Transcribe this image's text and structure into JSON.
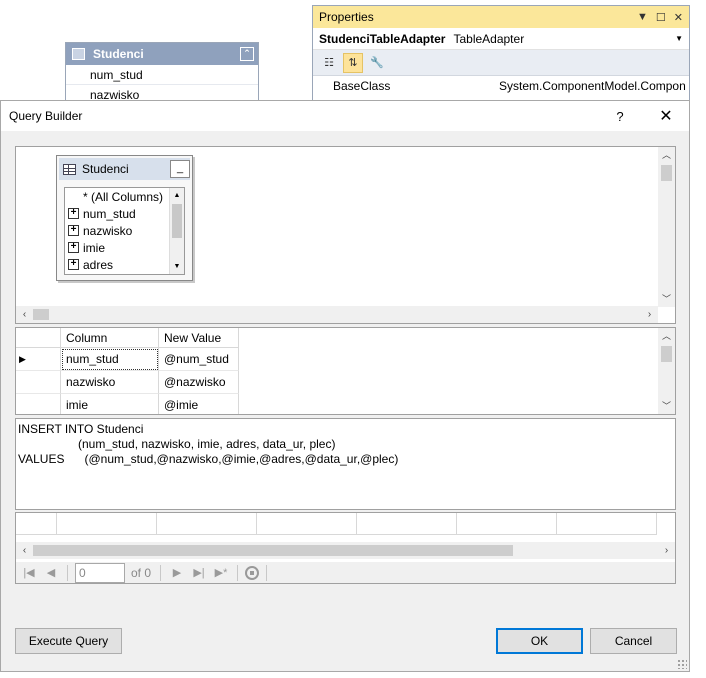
{
  "background": {
    "table": {
      "title": "Studenci",
      "rows": [
        "num_stud",
        "nazwisko"
      ]
    },
    "properties": {
      "title": "Properties",
      "object_name": "StudenciTableAdapter",
      "object_type": "TableAdapter",
      "row": {
        "name": "BaseClass",
        "value": "System.ComponentModel.Compon"
      }
    }
  },
  "dialog": {
    "title": "Query Builder",
    "help_label": "?",
    "close_label": "✕",
    "diagram": {
      "table_title": "Studenci",
      "columns": [
        "* (All Columns)",
        "num_stud",
        "nazwisko",
        "imie",
        "adres"
      ]
    },
    "criteria": {
      "headers": {
        "column": "Column",
        "new_value": "New Value"
      },
      "rows": [
        {
          "column": "num_stud",
          "value": "@num_stud"
        },
        {
          "column": "nazwisko",
          "value": "@nazwisko"
        },
        {
          "column": "imie",
          "value": "@imie"
        }
      ]
    },
    "sql_text": "INSERT INTO Studenci\n                  (num_stud, nazwisko, imie, adres, data_ur, plec)\nVALUES      (@num_stud,@nazwisko,@imie,@adres,@data_ur,@plec)",
    "navigator": {
      "position": "0",
      "of_label": "of 0"
    },
    "buttons": {
      "execute": "Execute Query",
      "ok": "OK",
      "cancel": "Cancel"
    }
  }
}
